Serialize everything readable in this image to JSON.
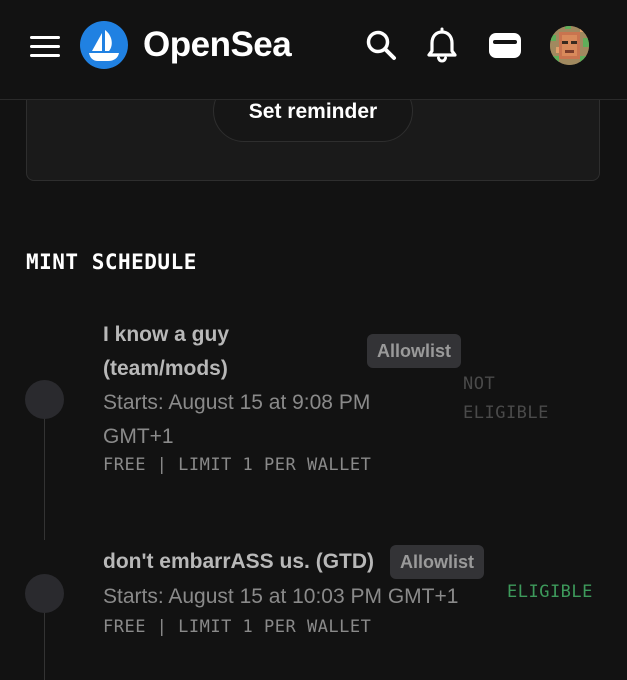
{
  "header": {
    "brand": "OpenSea",
    "icons": [
      "menu-icon",
      "opensea-logo-icon",
      "search-icon",
      "bell-icon",
      "wallet-icon",
      "avatar"
    ]
  },
  "card": {
    "reminder_label": "Set reminder"
  },
  "schedule": {
    "title": "MINT SCHEDULE",
    "phases": [
      {
        "name_line1": "I know a guy",
        "name_line2": "(team/mods)",
        "badge": "Allowlist",
        "starts_line1": "Starts: August 15 at 9:08 PM",
        "starts_line2": "GMT+1",
        "meta": "FREE | LIMIT 1 PER WALLET",
        "status_line1": "NOT",
        "status_line2": "ELIGIBLE",
        "status_color": "#4a4a4a"
      },
      {
        "name": "don't embarrASS us. (GTD)",
        "badge": "Allowlist",
        "starts": "Starts: August 15 at 10:03 PM GMT+1",
        "meta": "FREE | LIMIT 1 PER WALLET",
        "status": "ELIGIBLE",
        "status_color": "#3d9a5b"
      }
    ]
  },
  "colors": {
    "background": "#121212",
    "brand_blue": "#2081e2",
    "eligible_green": "#3d9a5b",
    "not_eligible_gray": "#4a4a4a"
  }
}
